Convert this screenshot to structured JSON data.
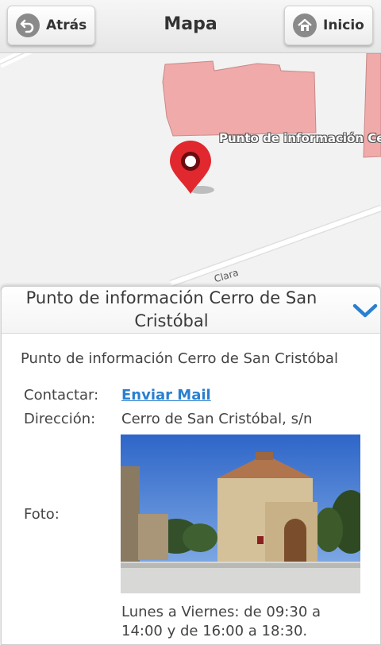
{
  "header": {
    "title": "Mapa",
    "back_label": "Atrás",
    "home_label": "Inicio"
  },
  "map": {
    "poi_label": "Punto de información Cerro de San Cristóbal",
    "street_label": "Clara"
  },
  "panel": {
    "title": "Punto de información Cerro de San Cristóbal",
    "subtitle": "Punto de información Cerro de San Cristóbal",
    "contact_label": "Contactar:",
    "contact_value": "Enviar Mail",
    "address_label": "Dirección:",
    "address_value": "Cerro de San Cristóbal, s/n",
    "photo_label": "Foto:",
    "hours": "Lunes a Viernes: de 09:30 a 14:00 y de 16:00 a 18:30."
  },
  "colors": {
    "accent": "#2a7fd0",
    "building": "#f0aaaa",
    "marker": "#e0282e"
  }
}
